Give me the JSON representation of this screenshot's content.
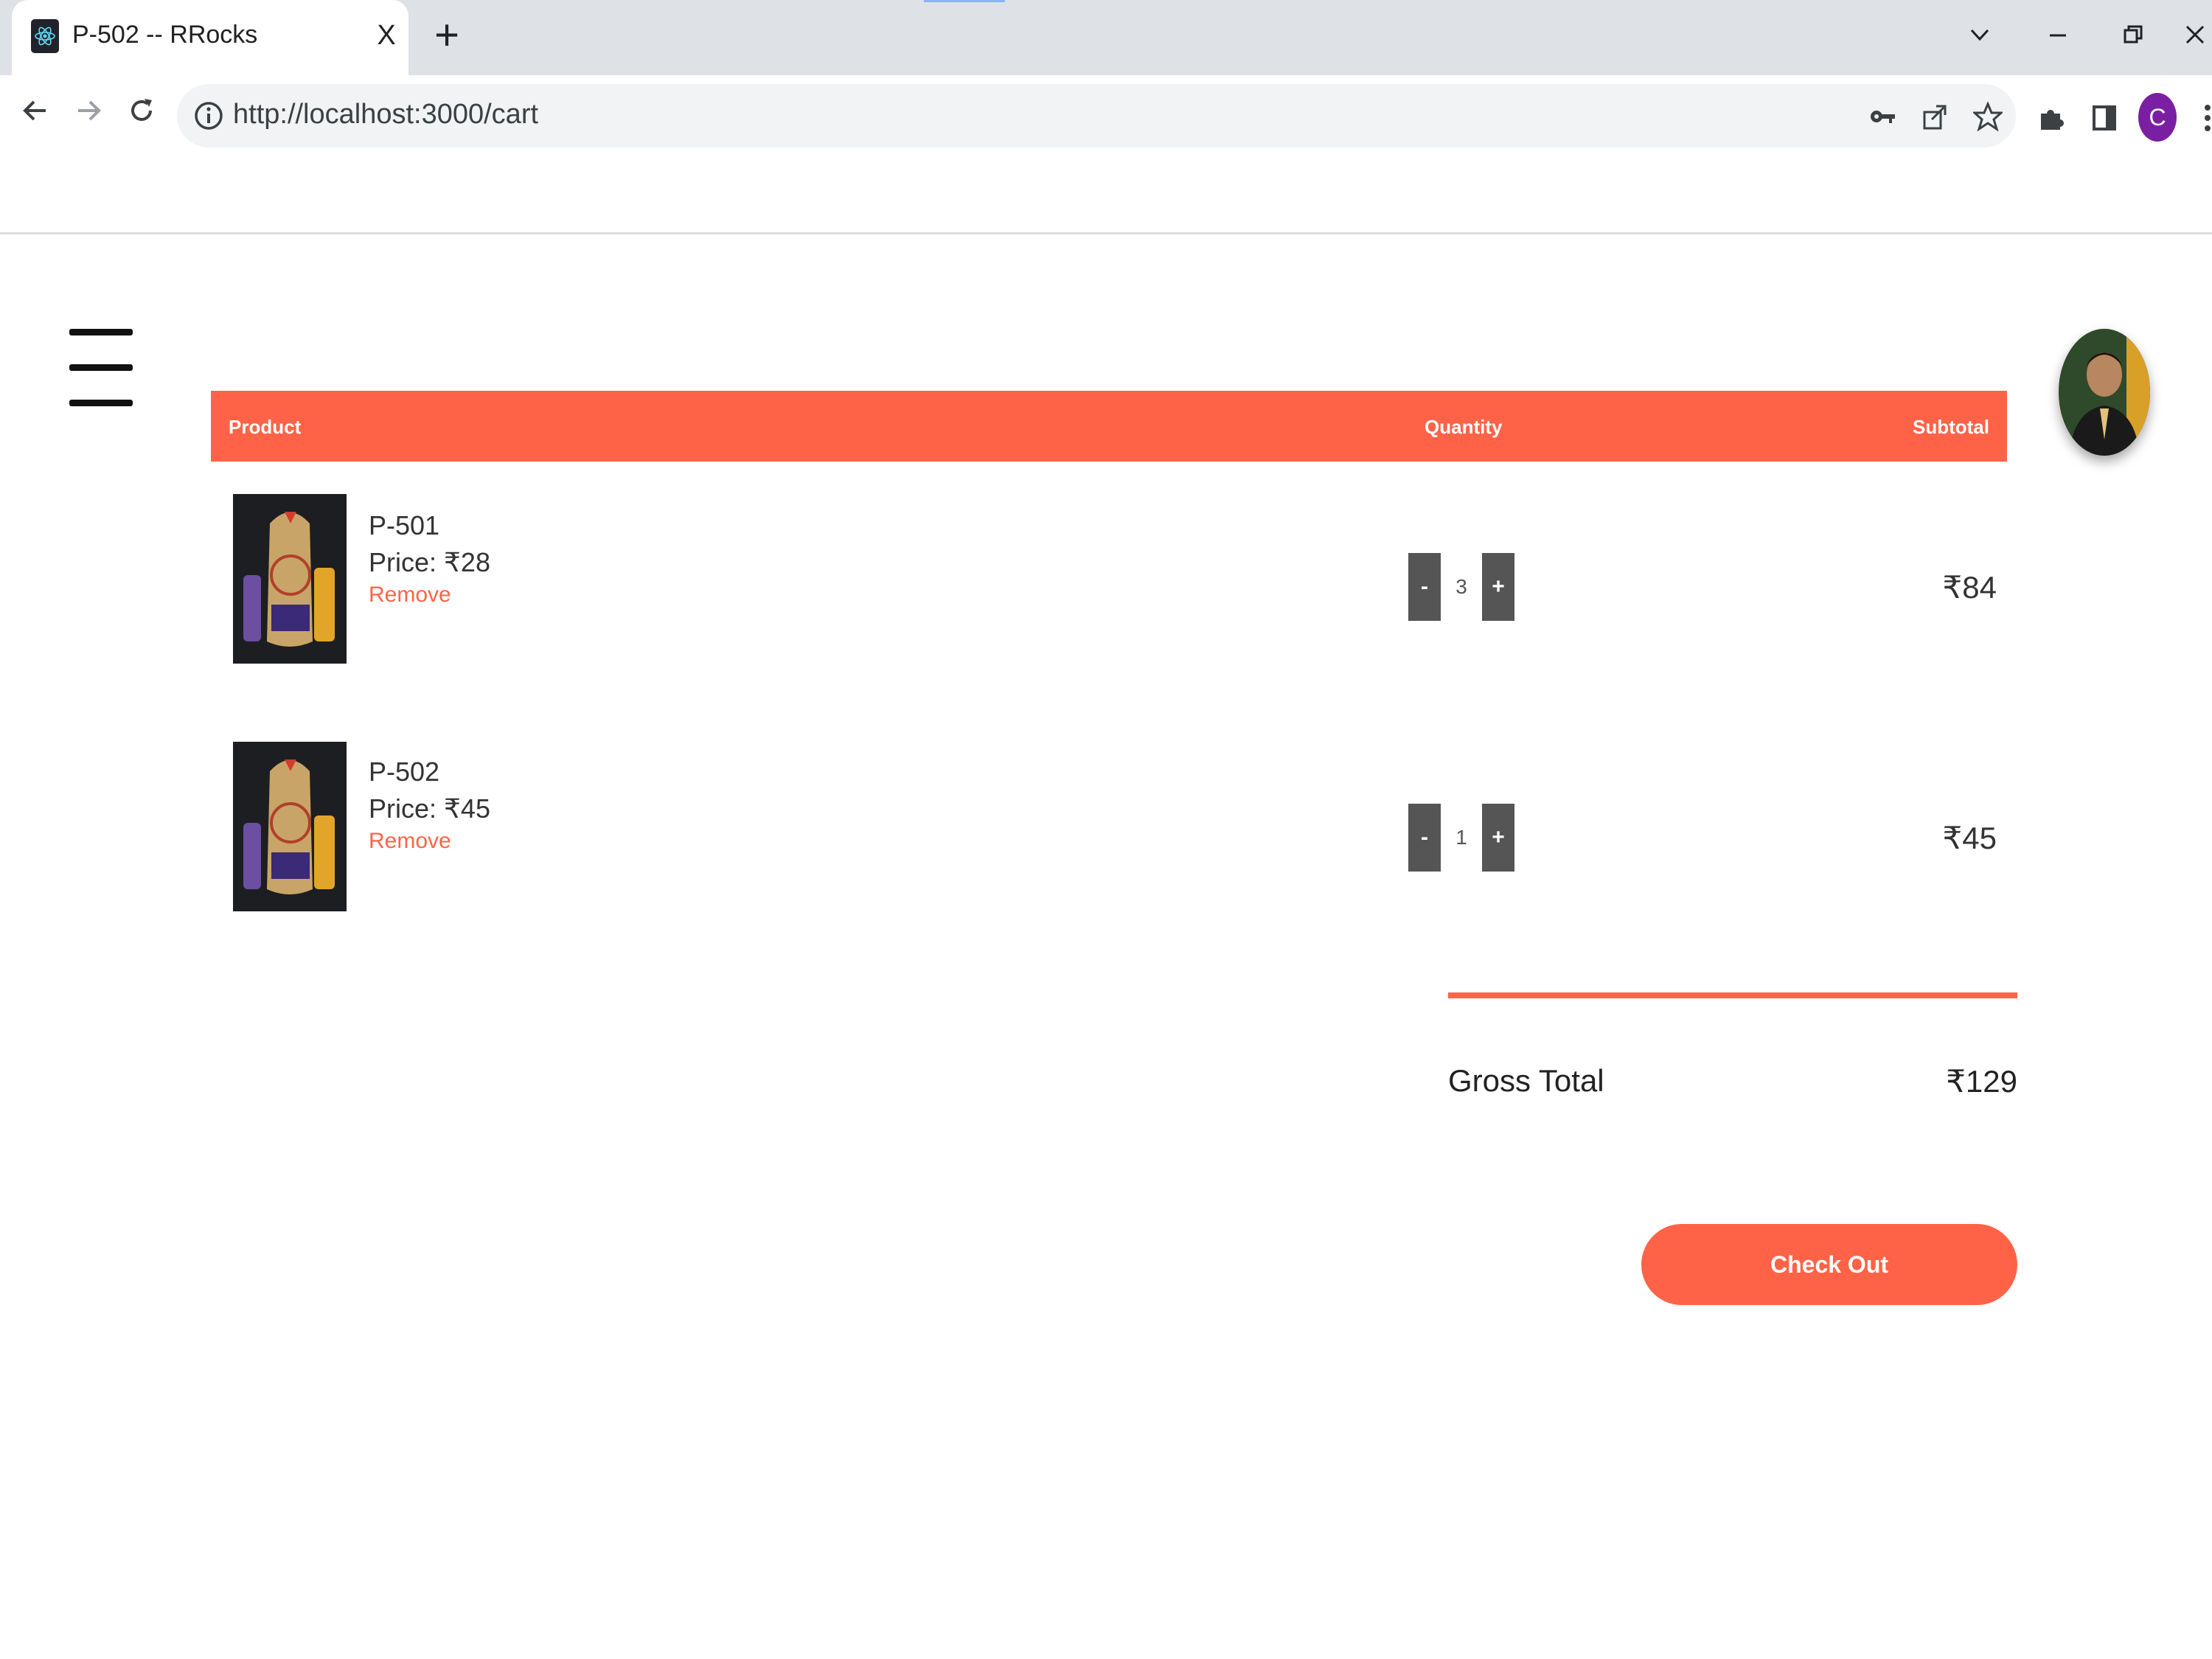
{
  "browser": {
    "tab_title": "P-502 -- RRocks",
    "tab_close": "X",
    "new_tab": "+",
    "url": "http://localhost:3000/cart",
    "profile_initial": "C",
    "accent_color": "#8ab4f8",
    "icons": [
      "react-favicon",
      "back-arrow-icon",
      "forward-arrow-icon",
      "reload-icon",
      "info-icon",
      "key-icon",
      "share-icon",
      "star-icon",
      "puzzle-icon",
      "side-panel-icon",
      "kebab-menu-icon",
      "chevron-down-icon",
      "minimize-icon",
      "restore-icon",
      "close-icon"
    ]
  },
  "page": {
    "accent_color": "#ff6347",
    "header": {
      "product": "Product",
      "quantity": "Quantity",
      "subtotal": "Subtotal"
    },
    "items": [
      {
        "name": "P-501",
        "price": "Price: ₹28",
        "remove": "Remove",
        "minus": "-",
        "qty": "3",
        "plus": "+",
        "subtotal": "₹84"
      },
      {
        "name": "P-502",
        "price": "Price: ₹45",
        "remove": "Remove",
        "minus": "-",
        "qty": "1",
        "plus": "+",
        "subtotal": "₹45"
      }
    ],
    "gross_total_label": "Gross Total",
    "gross_total_value": "₹129",
    "checkout_label": "Check Out"
  }
}
